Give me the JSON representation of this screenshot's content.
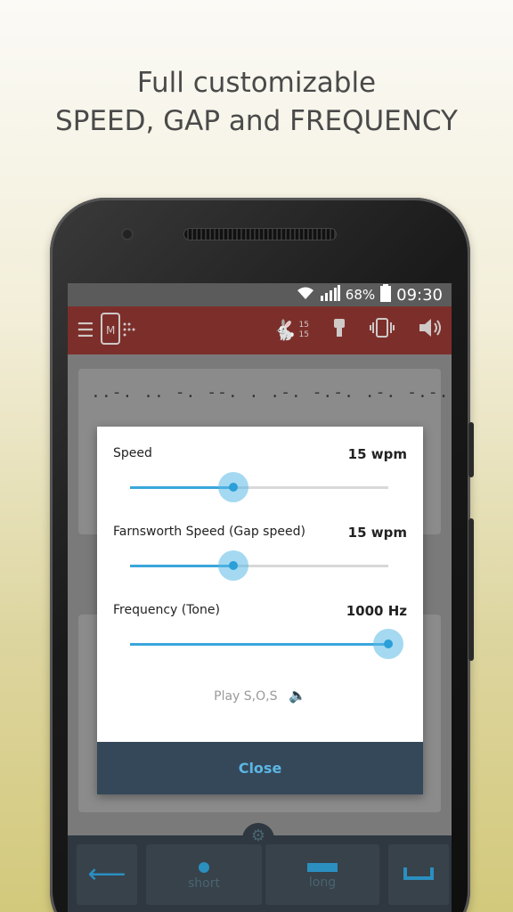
{
  "headline": {
    "line1": "Full customizable",
    "line2": "SPEED, GAP and FREQUENCY"
  },
  "status_bar": {
    "battery": "68%",
    "time": "09:30"
  },
  "app_bar": {
    "speed_small_top": "15",
    "speed_small_bottom": "15"
  },
  "main": {
    "morse_line": "..-. .. -. --. . .-. -.-. .-. -.-. .-.-"
  },
  "keyboard": {
    "short_label": "short",
    "long_label": "long"
  },
  "dialog": {
    "speed": {
      "label": "Speed",
      "value": "15 wpm",
      "level": 0.4
    },
    "farnsworth": {
      "label": "Farnsworth Speed (Gap speed)",
      "value": "15 wpm",
      "level": 0.4
    },
    "frequency": {
      "label": "Frequency (Tone)",
      "value": "1000 Hz",
      "level": 1.0
    },
    "play_label": "Play S,O,S",
    "close_label": "Close"
  },
  "colors": {
    "accent": "#3aa6dc",
    "app_bar": "#7c2f2a",
    "close_bar": "#354859"
  }
}
